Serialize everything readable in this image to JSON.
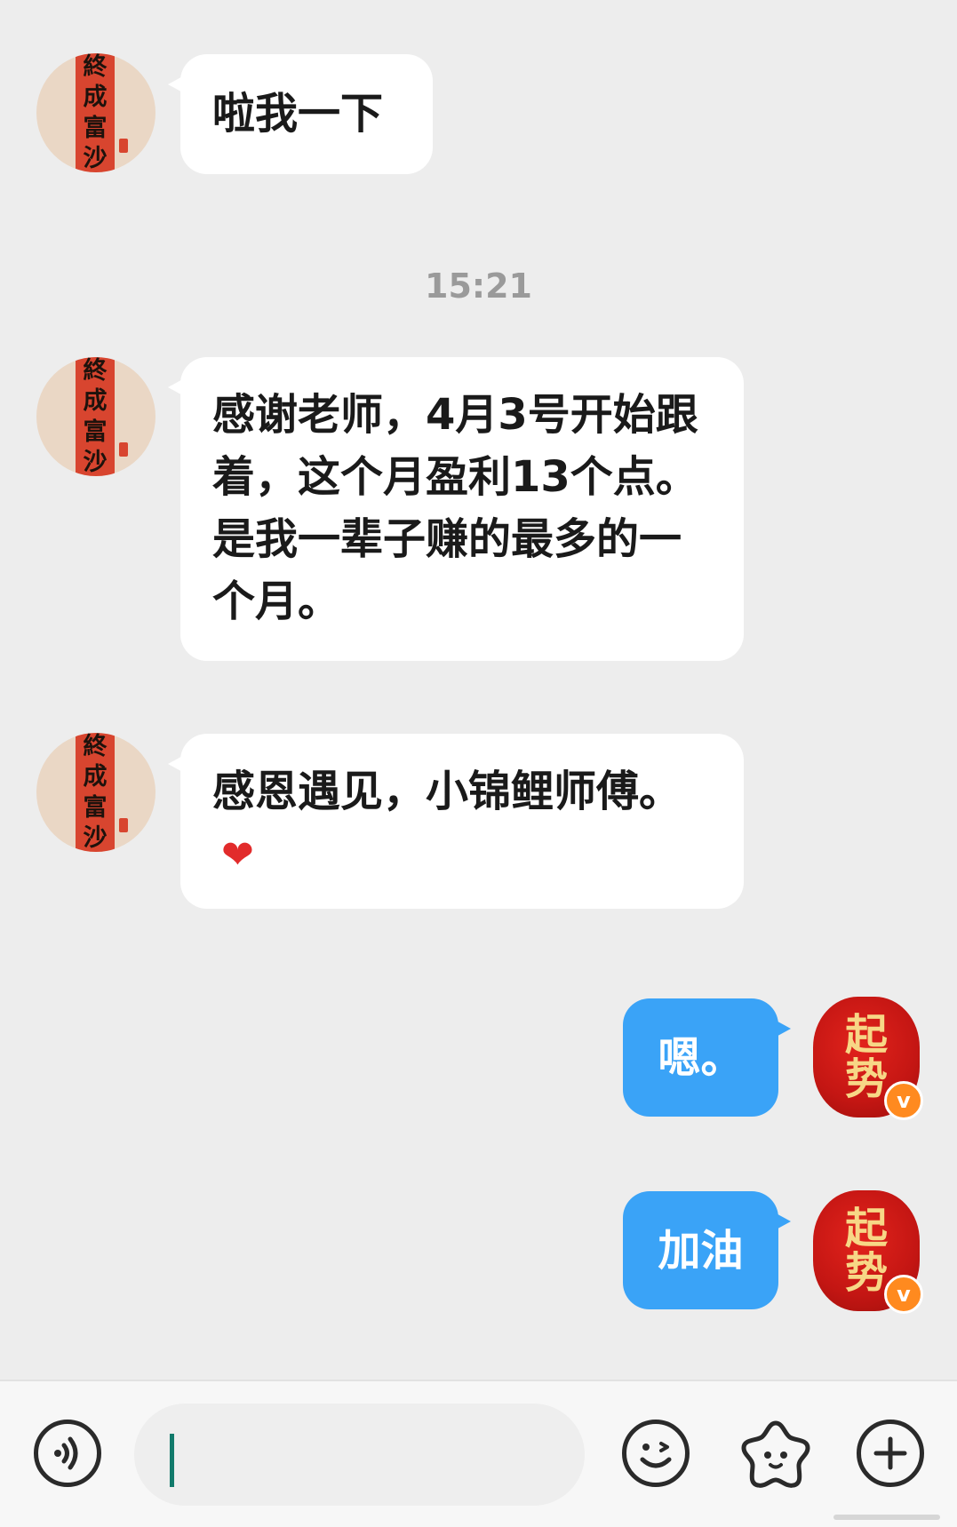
{
  "messages": [
    {
      "side": "left",
      "text": "啦我一下"
    },
    {
      "side": "left",
      "text": "感谢老师，4月3号开始跟着，这个月盈利13个点。是我一辈子赚的最多的一个月。"
    },
    {
      "side": "left",
      "text": "感恩遇见，小锦鲤师傅。",
      "emoji": "❤"
    },
    {
      "side": "right",
      "text": "嗯。"
    },
    {
      "side": "right",
      "text": "加油"
    }
  ],
  "timestamp": "15:21",
  "avatars": {
    "left": {
      "chars": [
        "終",
        "成",
        "富",
        "沙"
      ]
    },
    "right": {
      "chars": [
        "起",
        "势"
      ],
      "badge": "v"
    }
  },
  "input": {
    "placeholder": ""
  },
  "colors": {
    "background": "#ededed",
    "bubble_left": "#ffffff",
    "bubble_right": "#3aa3f7",
    "timestamp": "#9a9a9a",
    "caret": "#117a6b"
  },
  "icons": [
    "voice-icon",
    "emoji-icon",
    "sticker-icon",
    "plus-icon"
  ]
}
